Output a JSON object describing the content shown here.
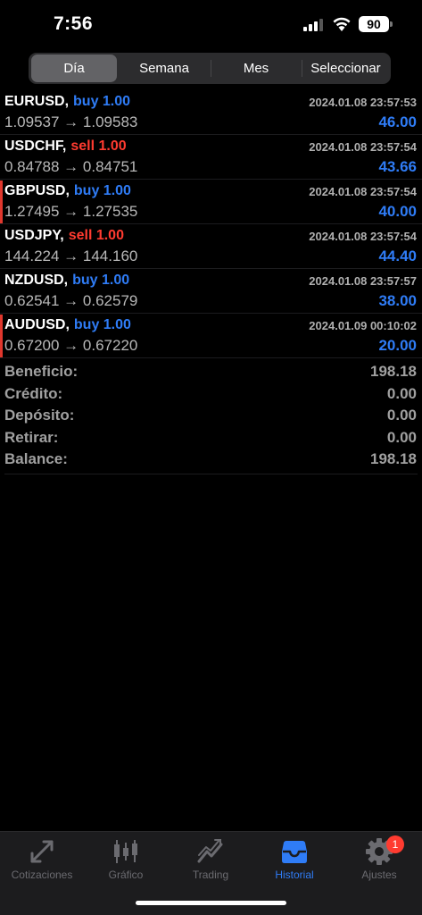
{
  "status_bar": {
    "time": "7:56",
    "battery": "90"
  },
  "segments": {
    "items": [
      "Día",
      "Semana",
      "Mes",
      "Seleccionar"
    ],
    "active": "Día"
  },
  "deals": [
    {
      "symbol": "EURUSD,",
      "type": "buy 1.00",
      "side": "buy",
      "date": "2024.01.08 23:57:53",
      "prices": "1.09537 → 1.09583",
      "profit": "46.00",
      "marker": false
    },
    {
      "symbol": "USDCHF,",
      "type": "sell 1.00",
      "side": "sell",
      "date": "2024.01.08 23:57:54",
      "prices": "0.84788 → 0.84751",
      "profit": "43.66",
      "marker": false
    },
    {
      "symbol": "GBPUSD,",
      "type": "buy 1.00",
      "side": "buy",
      "date": "2024.01.08 23:57:54",
      "prices": "1.27495 → 1.27535",
      "profit": "40.00",
      "marker": true
    },
    {
      "symbol": "USDJPY,",
      "type": "sell 1.00",
      "side": "sell",
      "date": "2024.01.08 23:57:54",
      "prices": "144.224 → 144.160",
      "profit": "44.40",
      "marker": false
    },
    {
      "symbol": "NZDUSD,",
      "type": "buy 1.00",
      "side": "buy",
      "date": "2024.01.08 23:57:57",
      "prices": "0.62541 → 0.62579",
      "profit": "38.00",
      "marker": false
    },
    {
      "symbol": "AUDUSD,",
      "type": "buy 1.00",
      "side": "buy",
      "date": "2024.01.09 00:10:02",
      "prices": "0.67200 → 0.67220",
      "profit": "20.00",
      "marker": true
    }
  ],
  "summary": [
    {
      "label": "Beneficio:",
      "value": "198.18"
    },
    {
      "label": "Crédito:",
      "value": "0.00"
    },
    {
      "label": "Depósito:",
      "value": "0.00"
    },
    {
      "label": "Retirar:",
      "value": "0.00"
    },
    {
      "label": "Balance:",
      "value": "198.18"
    }
  ],
  "tabbar": {
    "items": [
      {
        "label": "Cotizaciones",
        "icon": "quotes-icon"
      },
      {
        "label": "Gráfico",
        "icon": "candlestick-chart-icon"
      },
      {
        "label": "Trading",
        "icon": "trading-icon"
      },
      {
        "label": "Historial",
        "icon": "history-inbox-icon"
      },
      {
        "label": "Ajustes",
        "icon": "gear-icon"
      }
    ],
    "active": "Historial",
    "badge": "1"
  },
  "colors": {
    "buy": "#2f7cf6",
    "sell": "#ff3b30",
    "marker": "#e0372d",
    "active_tab": "#2f7cf6"
  }
}
